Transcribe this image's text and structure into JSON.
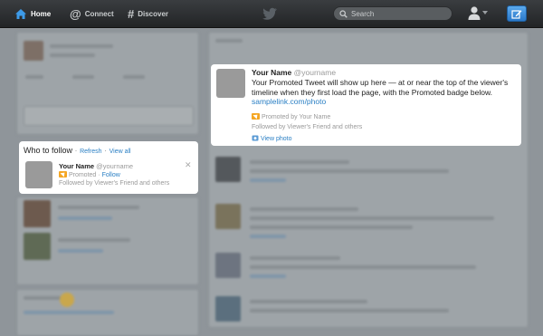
{
  "topbar": {
    "home_label": "Home",
    "connect_label": "Connect",
    "discover_label": "Discover",
    "search_placeholder": "Search"
  },
  "who_to_follow": {
    "title": "Who to follow",
    "separator": "·",
    "refresh_label": "Refresh",
    "view_all_label": "View all",
    "suggestion": {
      "name": "Your Name",
      "handle": "@yourname",
      "promoted_label": "Promoted",
      "follow_label": "Follow",
      "followed_by": "Followed by Viewer's Friend and others"
    }
  },
  "promoted_tweet": {
    "name": "Your Name",
    "handle": "@yourname",
    "text": "Your Promoted Tweet will show up here — at or near the top of the viewer's timeline when they first load the page, with the Promoted badge below.",
    "link": "samplelink.com/photo",
    "promoted_by": "Promoted by Your Name",
    "followed_by": "Followed by Viewer's Friend and others",
    "view_photo_label": "View photo"
  },
  "colors": {
    "link": "#2a7fc4",
    "promoted_badge": "#f5a623",
    "topbar": "#2a2c2e"
  }
}
